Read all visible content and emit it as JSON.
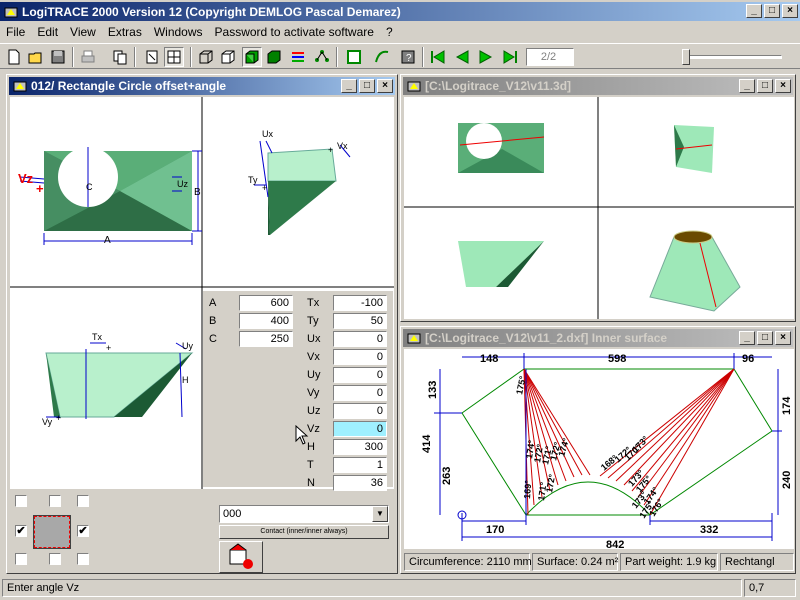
{
  "app": {
    "title": "LogiTRACE 2000  Version 12  (Copyright DEMLOG Pascal Demarez)"
  },
  "menu": [
    "File",
    "Edit",
    "View",
    "Extras",
    "Windows",
    "Password to activate software",
    "?"
  ],
  "toolbar": {
    "page_indicator": "2/2"
  },
  "left_window": {
    "title": "012/ Rectangle Circle offset+angle",
    "dim_labels": {
      "a": "A",
      "b": "B",
      "c": "C",
      "uz": "Uz",
      "ux": "Ux",
      "vx": "Vx",
      "ty": "Ty",
      "tx": "Tx",
      "uy": "Uy",
      "vy": "Vy",
      "h": "H",
      "vz": "Vz"
    },
    "params_left": [
      {
        "label": "A",
        "value": "600"
      },
      {
        "label": "B",
        "value": "400"
      },
      {
        "label": "C",
        "value": "250"
      }
    ],
    "params_right": [
      {
        "label": "Tx",
        "value": "-100"
      },
      {
        "label": "Ty",
        "value": "50"
      },
      {
        "label": "Ux",
        "value": "0"
      },
      {
        "label": "Vx",
        "value": "0"
      },
      {
        "label": "Uy",
        "value": "0"
      },
      {
        "label": "Vy",
        "value": "0"
      },
      {
        "label": "Uz",
        "value": "0"
      },
      {
        "label": "Vz",
        "value": "0"
      },
      {
        "label": "H",
        "value": "300"
      },
      {
        "label": "T",
        "value": "1"
      },
      {
        "label": "N",
        "value": "36"
      }
    ],
    "combo_value": "000",
    "contact_label": "Contact (inner/inner always)"
  },
  "view3d_window": {
    "title": "[C:\\Logitrace_V12\\v11.3d]"
  },
  "dxf_window": {
    "title": "[C:\\Logitrace_V12\\v11_2.dxf]  Inner surface",
    "dims": {
      "top1": "148",
      "top2": "598",
      "top3": "96",
      "left1": "133",
      "left2": "414",
      "left3": "263",
      "right1": "174",
      "right2": "240",
      "bottom1": "170",
      "bottom2": "332",
      "bottom3": "842"
    },
    "angle_labels_left": [
      "175°",
      "174°",
      "172°",
      "171°",
      "172°",
      "174°",
      "169°",
      "171°",
      "172°"
    ],
    "angle_labels_right": [
      "168°",
      "172°",
      "170°",
      "173°",
      "173°",
      "175°",
      "173°",
      "174°",
      "175°",
      "176°"
    ],
    "status": {
      "circumference": "Circumference: 2110 mm",
      "surface": "Surface: 0.24 m²",
      "weight": "Part weight: 1.9 kg",
      "shape": "Rechtangl"
    }
  },
  "statusbar": {
    "message": "Enter angle Vz",
    "value": "0,7"
  },
  "colors": {
    "title_active": "#0a246a",
    "title_inactive": "#808080",
    "surface": "#9ee8b8",
    "dim_blue": "#0000c0",
    "highlight_field": "#9ff0ff"
  }
}
